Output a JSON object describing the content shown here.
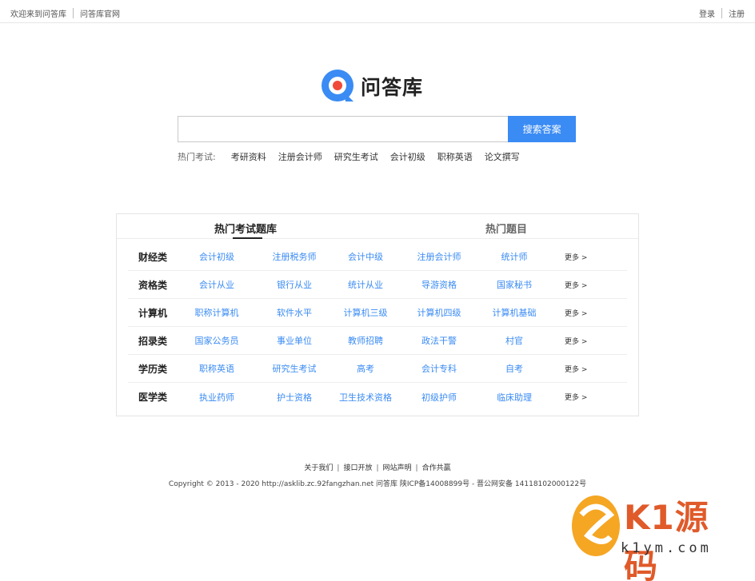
{
  "topbar": {
    "welcome": "欢迎来到问答库",
    "official": "问答库官网",
    "login": "登录",
    "register": "注册"
  },
  "logo": {
    "text": "问答库",
    "colors": {
      "blue": "#3a8bf4",
      "red": "#f04a3a"
    }
  },
  "search": {
    "value": "",
    "placeholder": "",
    "button": "搜索答案"
  },
  "hot_exams": {
    "label": "热门考试:",
    "items": [
      "考研资料",
      "注册会计师",
      "研究生考试",
      "会计初级",
      "职称英语",
      "论文撰写"
    ]
  },
  "tabs": {
    "tab1": "热门考试题库",
    "tab2": "热门题目"
  },
  "categories": [
    {
      "name": "财经类",
      "items": [
        "会计初级",
        "注册税务师",
        "会计中级",
        "注册会计师",
        "统计师"
      ],
      "more": "更多 >"
    },
    {
      "name": "资格类",
      "items": [
        "会计从业",
        "银行从业",
        "统计从业",
        "导游资格",
        "国家秘书"
      ],
      "more": "更多 >"
    },
    {
      "name": "计算机",
      "items": [
        "职称计算机",
        "软件水平",
        "计算机三级",
        "计算机四级",
        "计算机基础"
      ],
      "more": "更多 >"
    },
    {
      "name": "招录类",
      "items": [
        "国家公务员",
        "事业单位",
        "教师招聘",
        "政法干警",
        "村官"
      ],
      "more": "更多 >"
    },
    {
      "name": "学历类",
      "items": [
        "职称英语",
        "研究生考试",
        "高考",
        "会计专科",
        "自考"
      ],
      "more": "更多 >"
    },
    {
      "name": "医学类",
      "items": [
        "执业药师",
        "护士资格",
        "卫生技术资格",
        "初级护师",
        "临床助理"
      ],
      "more": "更多 >"
    }
  ],
  "footer": {
    "links": [
      "关于我们",
      "接口开放",
      "网站声明",
      "合作共赢"
    ],
    "copyright": "Copyright © 2013 - 2020 http://asklib.zc.92fangzhan.net  问答库   陕ICP备14008899号 - 晋公网安备 14118102000122号"
  },
  "watermark": {
    "text": "K1源码",
    "url": "k1ym.com"
  }
}
